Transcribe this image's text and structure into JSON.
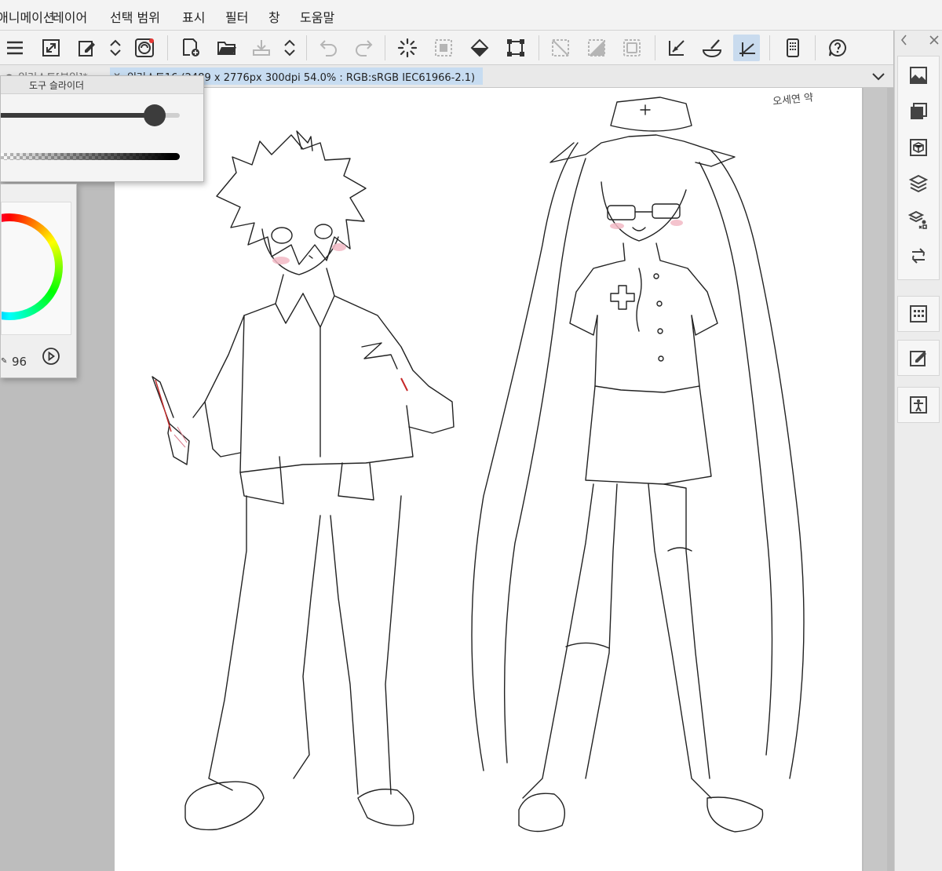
{
  "menubar": {
    "items": [
      "애니메이션",
      "레이어",
      "선택 범위",
      "표시",
      "필터",
      "창",
      "도움말"
    ]
  },
  "toolbar": {
    "icons": [
      "menu-icon",
      "resize-icon",
      "edit-icon",
      "chevrons-icon",
      "logo-icon",
      "new-canvas-icon",
      "open-folder-icon",
      "save-icon",
      "chevrons-icon",
      "undo-icon",
      "redo-icon",
      "loading-icon",
      "select-all-icon",
      "fill-icon",
      "transform-icon",
      "clear-selection-icon",
      "invert-selection-icon",
      "border-icon",
      "ruler-icon",
      "snap-icon",
      "snap-active-icon",
      "device-icon",
      "help-icon"
    ]
  },
  "tabs": {
    "inactive_label": "일러스트[분일]*",
    "active_label": "일러스트16 (2489 x 2776px 300dpi 54.0% : RGB:sRGB IEC61966-2.1)"
  },
  "slider_panel": {
    "title": "도구 슬라이더",
    "size_level": 0.86,
    "opacity_level": 1.0
  },
  "color_panel": {
    "value": "96"
  },
  "canvas": {
    "signature": "오세연 약"
  },
  "colors": {
    "accent": "#c7dcf1",
    "menubar_bg": "#f3f3f3",
    "workspace_bg": "#bdbdbd"
  }
}
